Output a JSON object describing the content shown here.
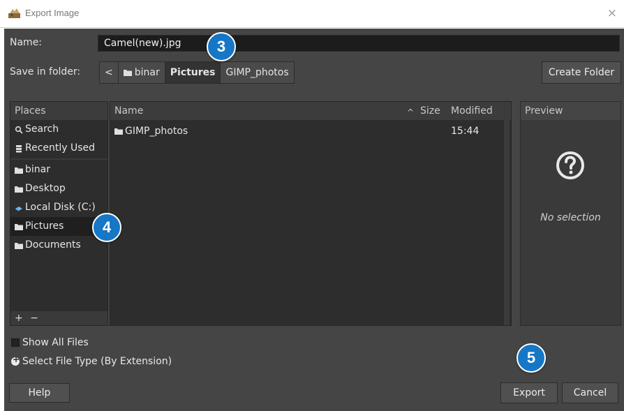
{
  "window": {
    "title": "Export Image",
    "close_glyph": "×",
    "app_icon": "gimp-icon"
  },
  "name_row": {
    "label": "Name:",
    "value": "Camel(new).jpg"
  },
  "folder_row": {
    "label": "Save in folder:",
    "back_glyph": "<",
    "segments": [
      "binar",
      "Pictures",
      "GIMP_photos"
    ],
    "active_segment": "Pictures",
    "create_folder": "Create Folder"
  },
  "places": {
    "header": "Places",
    "items": [
      {
        "label": "Search",
        "icon": "search-icon"
      },
      {
        "label": "Recently Used",
        "icon": "recent-icon"
      },
      {
        "label": "binar",
        "icon": "folder-icon"
      },
      {
        "label": "Desktop",
        "icon": "folder-icon"
      },
      {
        "label": "Local Disk (C:)",
        "icon": "drive-icon"
      },
      {
        "label": "Pictures",
        "icon": "folder-icon",
        "selected": true
      },
      {
        "label": "Documents",
        "icon": "folder-icon"
      }
    ],
    "add_glyph": "+",
    "remove_glyph": "−"
  },
  "files": {
    "columns": {
      "name": "Name",
      "size": "Size",
      "modified": "Modified"
    },
    "sort_glyph": "^",
    "rows": [
      {
        "name": "GIMP_photos",
        "size": "",
        "modified": "15:44",
        "icon": "folder-icon"
      }
    ]
  },
  "preview": {
    "header": "Preview",
    "placeholder": "No selection",
    "icon": "question-icon"
  },
  "options": {
    "show_all_files": "Show All Files",
    "file_type": "Select File Type (By Extension)"
  },
  "buttons": {
    "help": "Help",
    "export": "Export",
    "cancel": "Cancel"
  },
  "badges": {
    "b3": "3",
    "b4": "4",
    "b5": "5"
  },
  "colors": {
    "badge": "#1677c7",
    "dialog_bg": "#454545",
    "list_bg": "#2d2d2d"
  }
}
